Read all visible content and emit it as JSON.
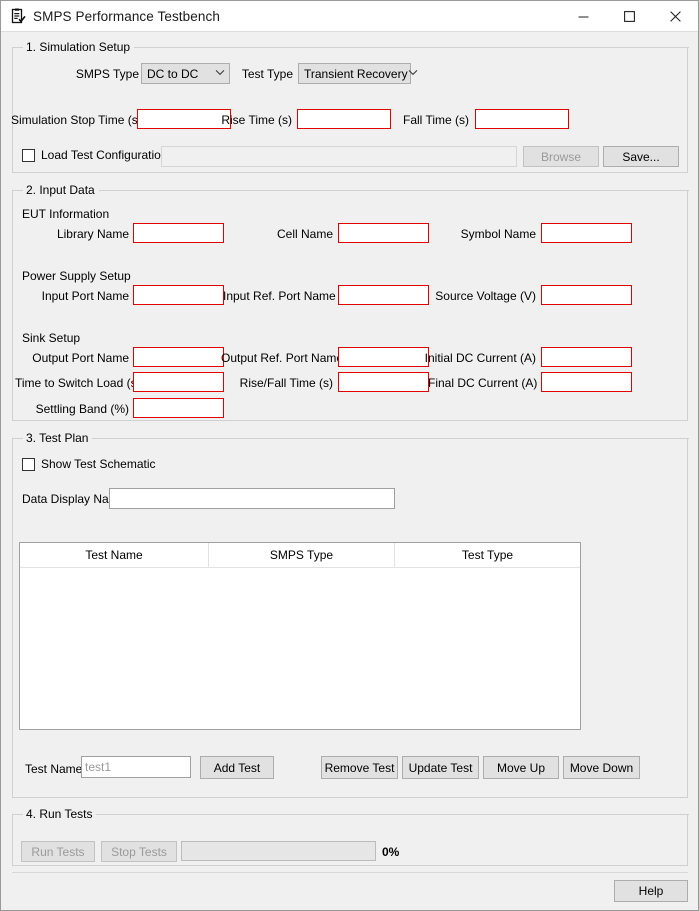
{
  "window": {
    "title": "SMPS Performance Testbench",
    "icon": "clipboard-check-icon",
    "minimize": "—",
    "maximize": "☐",
    "close": "✕"
  },
  "sections": {
    "simulation_setup": {
      "legend": "1. Simulation Setup",
      "smps_type_label": "SMPS Type",
      "smps_type_value": "DC to DC",
      "test_type_label": "Test Type",
      "test_type_value": "Transient Recovery",
      "sim_stop_time_label": "Simulation Stop Time (s)",
      "sim_stop_time_value": "",
      "rise_time_label": "Rise Time (s)",
      "rise_time_value": "",
      "fall_time_label": "Fall Time (s)",
      "fall_time_value": "",
      "load_config_label": "Load Test Configuration",
      "load_config_path": "",
      "browse_label": "Browse",
      "save_label": "Save..."
    },
    "input_data": {
      "legend": "2. Input Data",
      "eut_heading": "EUT Information",
      "library_name_label": "Library Name",
      "library_name_value": "",
      "cell_name_label": "Cell Name",
      "cell_name_value": "",
      "symbol_name_label": "Symbol Name",
      "symbol_name_value": "",
      "power_supply_heading": "Power Supply Setup",
      "input_port_label": "Input Port Name",
      "input_port_value": "",
      "input_ref_port_label": "Input Ref. Port Name",
      "input_ref_port_value": "",
      "source_voltage_label": "Source Voltage (V)",
      "source_voltage_value": "",
      "sink_heading": "Sink Setup",
      "output_port_label": "Output Port Name",
      "output_port_value": "",
      "output_ref_port_label": "Output Ref. Port Name",
      "output_ref_port_value": "",
      "initial_dc_current_label": "Initial DC Current (A)",
      "initial_dc_current_value": "",
      "time_to_switch_label": "Time to Switch Load (s)",
      "time_to_switch_value": "",
      "rise_fall_time_label": "Rise/Fall Time (s)",
      "rise_fall_time_value": "",
      "final_dc_current_label": "Final DC Current (A)",
      "final_dc_current_value": "",
      "settling_band_label": "Settling Band (%)",
      "settling_band_value": ""
    },
    "test_plan": {
      "legend": "3. Test Plan",
      "show_schematic_label": "Show Test Schematic",
      "data_display_name_label": "Data Display Name",
      "data_display_name_value": "",
      "table_columns": [
        "Test Name",
        "SMPS Type",
        "Test Type"
      ],
      "table_rows": [],
      "test_name_label": "Test Name",
      "test_name_value": "",
      "test_name_placeholder": "test1",
      "add_test_label": "Add Test",
      "remove_test_label": "Remove Test",
      "update_test_label": "Update Test",
      "move_up_label": "Move Up",
      "move_down_label": "Move Down"
    },
    "run_tests": {
      "legend": "4. Run Tests",
      "run_label": "Run Tests",
      "stop_label": "Stop Tests",
      "progress_percent": "0%",
      "progress_value": 0
    }
  },
  "footer": {
    "help_label": "Help"
  },
  "colors": {
    "required_field_border": "#e00000",
    "window_bg": "#f0f0f0",
    "button_face": "#e1e1e1",
    "disabled_text": "#9a9a9a"
  }
}
